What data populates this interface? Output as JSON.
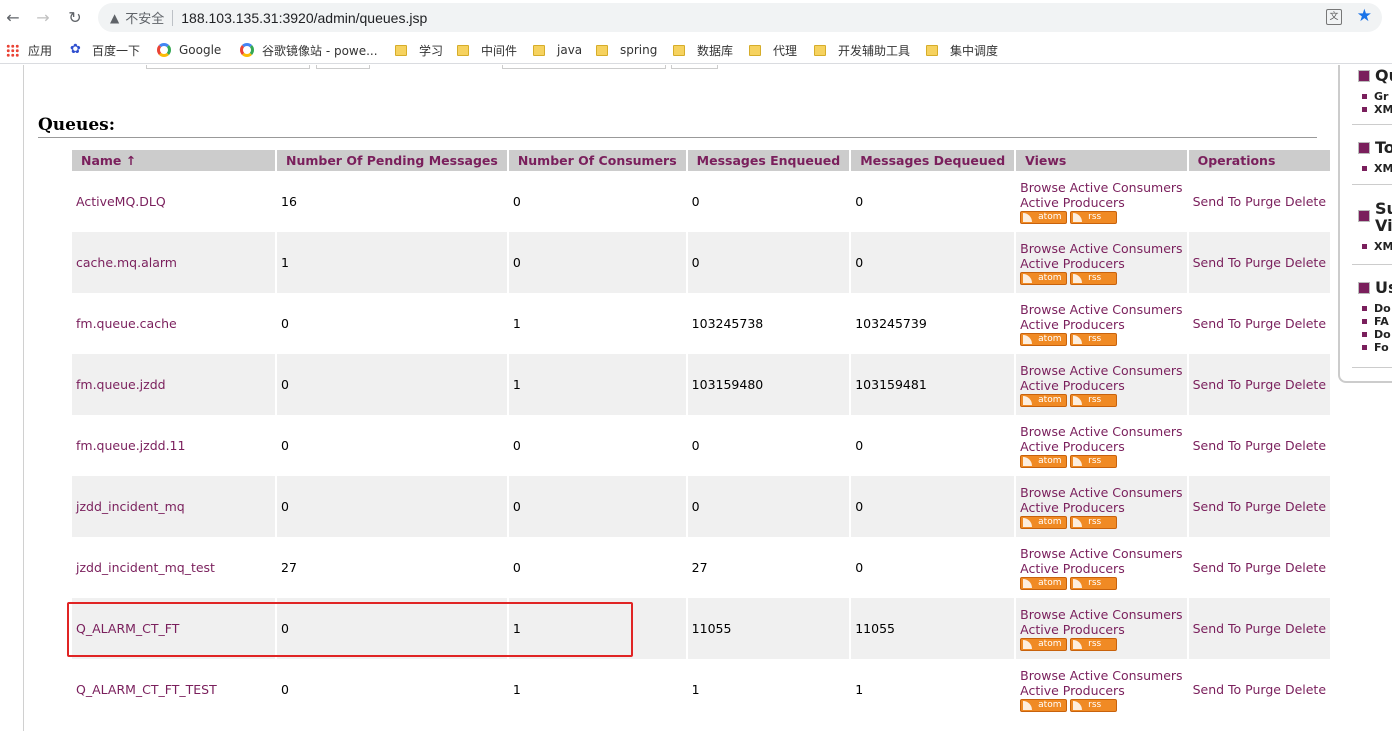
{
  "browser": {
    "security_label": "不安全",
    "url": "188.103.135.31:3920/admin/queues.jsp",
    "bookmarks": [
      {
        "label": "应用",
        "icon": "apps-grid-icon"
      },
      {
        "label": "百度一下",
        "icon": "baidu-paw-icon"
      },
      {
        "label": "Google",
        "icon": "google-icon"
      },
      {
        "label": "谷歌镜像站 - powe...",
        "icon": "google-icon"
      },
      {
        "label": "学习",
        "icon": "folder-icon"
      },
      {
        "label": "中间件",
        "icon": "folder-icon"
      },
      {
        "label": "java",
        "icon": "folder-icon"
      },
      {
        "label": "spring",
        "icon": "folder-icon"
      },
      {
        "label": "数据库",
        "icon": "folder-icon"
      },
      {
        "label": "代理",
        "icon": "folder-icon"
      },
      {
        "label": "开发辅助工具",
        "icon": "folder-icon"
      },
      {
        "label": "集中调度",
        "icon": "folder-icon"
      }
    ]
  },
  "page": {
    "heading": "Queues:",
    "columns": [
      "Name ↑",
      "Number Of Pending Messages",
      "Number Of Consumers",
      "Messages Enqueued",
      "Messages Dequeued",
      "Views",
      "Operations"
    ],
    "views_labels": {
      "browse": "Browse",
      "active_consumers": "Active Consumers",
      "active_producers": "Active Producers",
      "atom": "atom",
      "rss": "rss"
    },
    "operations_labels": {
      "send": "Send To",
      "purge": "Purge",
      "delete": "Delete"
    },
    "rows": [
      {
        "name": "ActiveMQ.DLQ",
        "pending": "16",
        "consumers": "0",
        "enqueued": "0",
        "dequeued": "0"
      },
      {
        "name": "cache.mq.alarm",
        "pending": "1",
        "consumers": "0",
        "enqueued": "0",
        "dequeued": "0"
      },
      {
        "name": "fm.queue.cache",
        "pending": "0",
        "consumers": "1",
        "enqueued": "103245738",
        "dequeued": "103245739"
      },
      {
        "name": "fm.queue.jzdd",
        "pending": "0",
        "consumers": "1",
        "enqueued": "103159480",
        "dequeued": "103159481"
      },
      {
        "name": "fm.queue.jzdd.11",
        "pending": "0",
        "consumers": "0",
        "enqueued": "0",
        "dequeued": "0"
      },
      {
        "name": "jzdd_incident_mq",
        "pending": "0",
        "consumers": "0",
        "enqueued": "0",
        "dequeued": "0"
      },
      {
        "name": "jzdd_incident_mq_test",
        "pending": "27",
        "consumers": "0",
        "enqueued": "27",
        "dequeued": "0"
      },
      {
        "name": "Q_ALARM_CT_FT",
        "pending": "0",
        "consumers": "1",
        "enqueued": "11055",
        "dequeued": "11055"
      },
      {
        "name": "Q_ALARM_CT_FT_TEST",
        "pending": "0",
        "consumers": "1",
        "enqueued": "1",
        "dequeued": "1"
      }
    ]
  },
  "sidebar": {
    "sections": [
      {
        "title": "Qu",
        "items": [
          "Gr",
          "XM"
        ]
      },
      {
        "title": "To",
        "items": [
          "XM"
        ]
      },
      {
        "title": "Su Vi",
        "items": [
          "XM"
        ]
      },
      {
        "title": "Us",
        "items": [
          "Do",
          "FA",
          "Do",
          "Fo"
        ]
      }
    ]
  },
  "colors": {
    "link": "#7a1f5c",
    "header_bg": "#cccccc",
    "highlight": "#e02424",
    "badge": "#f08a24"
  }
}
